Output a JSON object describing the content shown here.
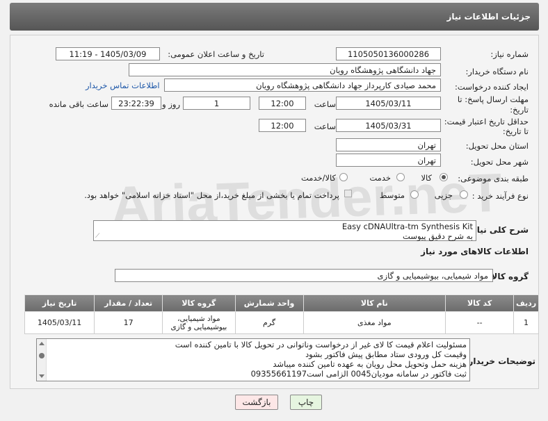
{
  "page_title": "جزئیات اطلاعات نیاز",
  "fields": {
    "need_number_label": "شماره نیاز:",
    "need_number": "1105050136000286",
    "announce_label": "تاریخ و ساعت اعلان عمومی:",
    "announce_value": "1405/03/09 - 11:19",
    "buyer_org_label": "نام دستگاه خریدار:",
    "buyer_org": "جهاد دانشگاهی پژوهشگاه رویان",
    "creator_label": "ایجاد کننده درخواست:",
    "creator": "محمد صیادی کارپرداز جهاد دانشگاهی پژوهشگاه رویان",
    "buyer_contact_link": "اطلاعات تماس خریدار",
    "deadline_label_1": "مهلت ارسال پاسخ: تا",
    "deadline_label_2": "تاریخ:",
    "deadline_date": "1405/03/11",
    "time_label": "ساعت",
    "deadline_time": "12:00",
    "days_value": "1",
    "days_label": "روز و",
    "remaining_time": "23:22:39",
    "remaining_label": "ساعت باقی مانده",
    "validity_label_1": "حداقل تاریخ اعتبار قیمت:",
    "validity_label_2": "تا تاریخ:",
    "validity_date": "1405/03/31",
    "validity_time": "12:00",
    "province_label": "استان محل تحویل:",
    "province": "تهران",
    "city_label": "شهر محل تحویل:",
    "city": "تهران",
    "category_label": "طبقه بندی موضوعی:",
    "category_options": [
      "کالا",
      "خدمت",
      "کالا/خدمت"
    ],
    "process_label": "نوع فرآیند خرید :",
    "process_options": [
      "جزیی",
      "متوسط"
    ],
    "payment_note": "پرداخت تمام یا بخشی از مبلغ خرید،از محل \"اسناد خزانه اسلامی\" خواهد بود.",
    "general_desc_label": "شرح کلی نیاز:",
    "general_desc_line1": "Easy cDNAUltra-tm Synthesis Kit",
    "general_desc_line2": "به شرح دقیق پیوست",
    "goods_info_title": "اطلاعات کالاهای مورد نیاز",
    "goods_group_label": "گروه کالا:",
    "goods_group": "مواد شیمیایی، بیوشیمیایی و  گازی"
  },
  "table": {
    "headers": [
      "ردیف",
      "کد کالا",
      "نام کالا",
      "واحد شمارش",
      "گروه کالا",
      "تعداد / مقدار",
      "تاریخ نیاز"
    ],
    "rows": [
      [
        "1",
        "--",
        "مواد مغذی",
        "گرم",
        "مواد شیمیایی، بیوشیمیایی و گازی",
        "17",
        "1405/03/11"
      ]
    ]
  },
  "buyer_notes_label": "توضیحات خریدار:",
  "buyer_notes": [
    "مسئولیت اعلام قیمت کا لای  غیر از درخواست وناتوانی در تحویل کالا با تامین کننده است",
    "وقیمت کل ورودی ستاد مطابق پیش فاکتور بشود",
    "هزینه حمل وتحویل محل رویان به عهده تامین کننده میباشد",
    "ثبت فاکتور در سامانه مودیان0045 الزامی است09355661197"
  ],
  "buttons": {
    "print": "چاپ",
    "back": "بازگشت"
  },
  "watermark": "AriaTender.neT",
  "colors": {
    "header_bg": "#666666",
    "link": "#1d57a8",
    "print_btn": "#e6f5e0",
    "back_btn": "#fde7e7"
  }
}
